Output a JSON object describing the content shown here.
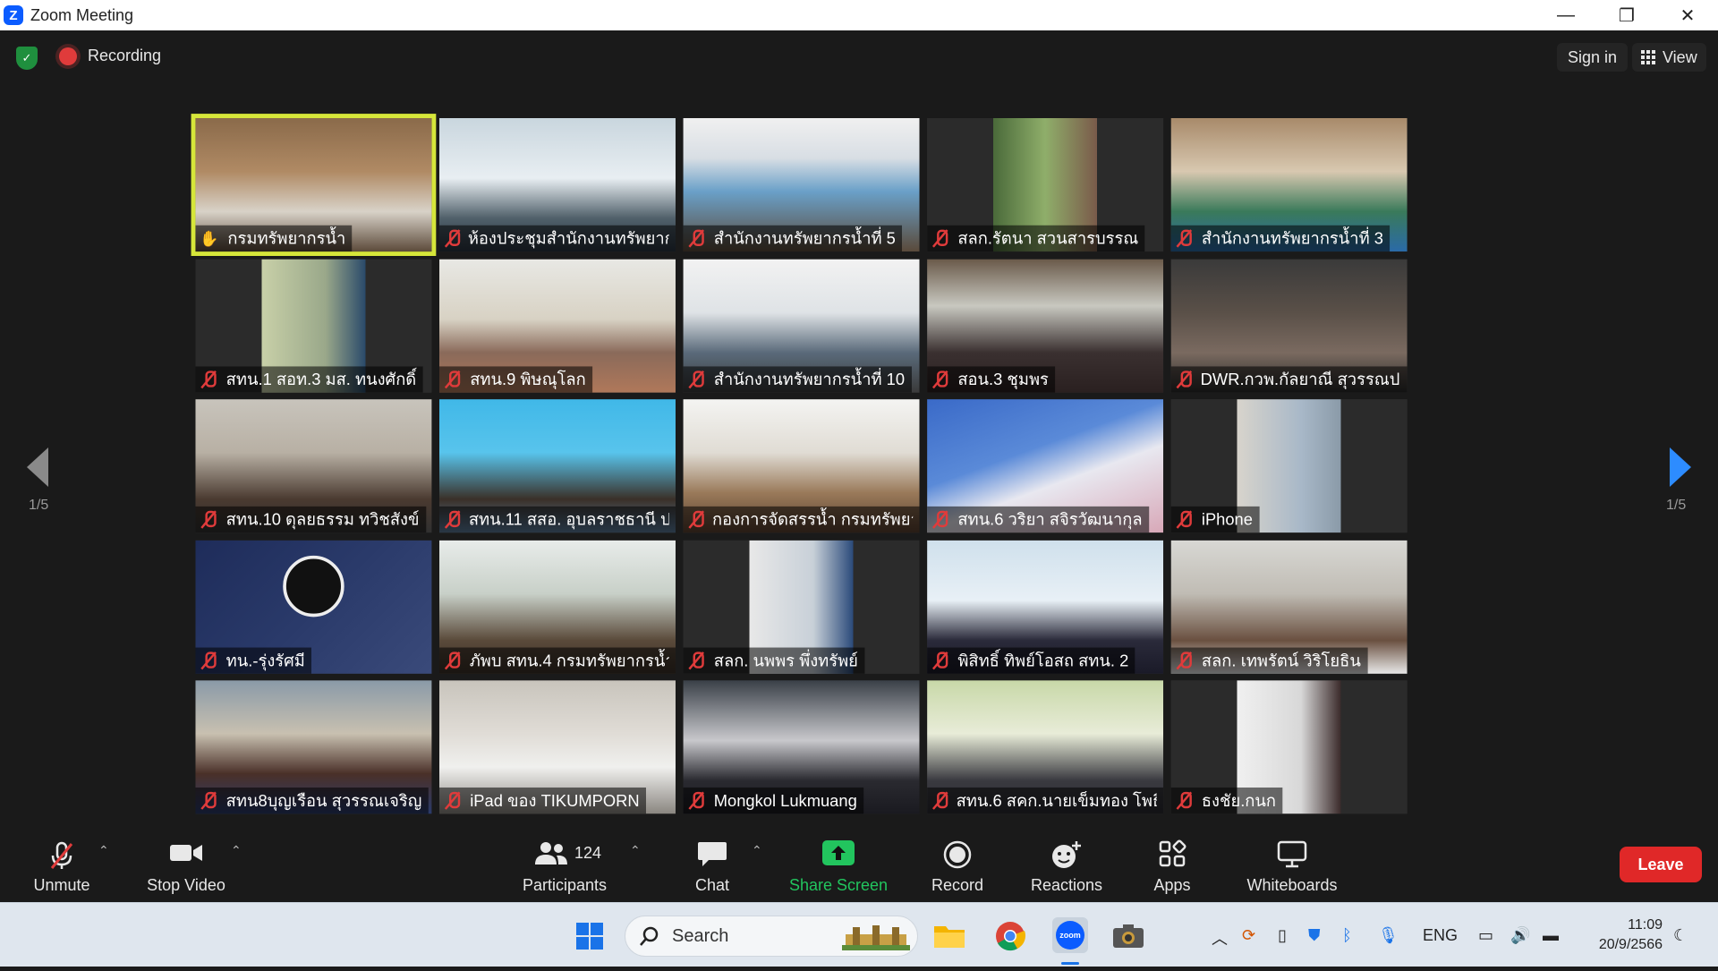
{
  "window": {
    "title": "Zoom Meeting",
    "minimize": "—",
    "restore": "❐",
    "close": "✕"
  },
  "topbar": {
    "recording": "Recording",
    "sign_in": "Sign in",
    "view": "View"
  },
  "paging": {
    "left": "1/5",
    "right": "1/5"
  },
  "tiles": [
    "กรมทรัพยากรน้ำ",
    "ห้องประชุมสำนักงานทรัพยากร...",
    "สำนักงานทรัพยากรน้ำที่ 5",
    "สลก.รัตนา สวนสารบรรณ",
    "สำนักงานทรัพยากรน้ำที่ 3",
    "สทน.1 สอท.3 มส. ทนงศักดิ์",
    "สทน.9 พิษณุโลก",
    "สำนักงานทรัพยากรน้ำที่ 10",
    "สอน.3 ชุมพร",
    "DWR.กวพ.กัลยาณี สุวรรณป...",
    "สทน.10 ดุลยธรรม ทวิชสังข์",
    "สทน.11 สสอ. อุบลราชธานี ป...",
    "กองการจัดสรรน้ำ กรมทรัพยา...",
    "สทน.6 วริยา สจิรวัฒนากุล",
    "iPhone",
    "ทน.-รุ่งรัศมี",
    "ภัพบ สทน.4 กรมทรัพยากรน้ำ",
    "สลก. นพพร พึ่งทรัพย์",
    "พิสิทธิ์ ทิพย์โอสถ สทน. 2",
    "สลก. เทพรัตน์ วิริโยธิน",
    "สทน8บุญเรือน สุวรรณเจริญ",
    "iPad ของ TIKUMPORN",
    "Mongkol Lukmuang",
    "สทน.6 สคก.นายเข็มทอง โพธิ์...",
    "ธงชัย.กนก"
  ],
  "toolbar": {
    "unmute": "Unmute",
    "stop_video": "Stop Video",
    "participants": "Participants",
    "participant_count": "124",
    "chat": "Chat",
    "share_screen": "Share Screen",
    "record": "Record",
    "reactions": "Reactions",
    "apps": "Apps",
    "whiteboards": "Whiteboards",
    "leave": "Leave"
  },
  "taskbar": {
    "search": "Search",
    "lang": "ENG",
    "time": "11:09",
    "date": "20/9/2566"
  },
  "colors": {
    "accent": "#2d8cff",
    "active_speaker": "#d6e63a",
    "share_green": "#22c55e",
    "leave_red": "#e02828"
  }
}
